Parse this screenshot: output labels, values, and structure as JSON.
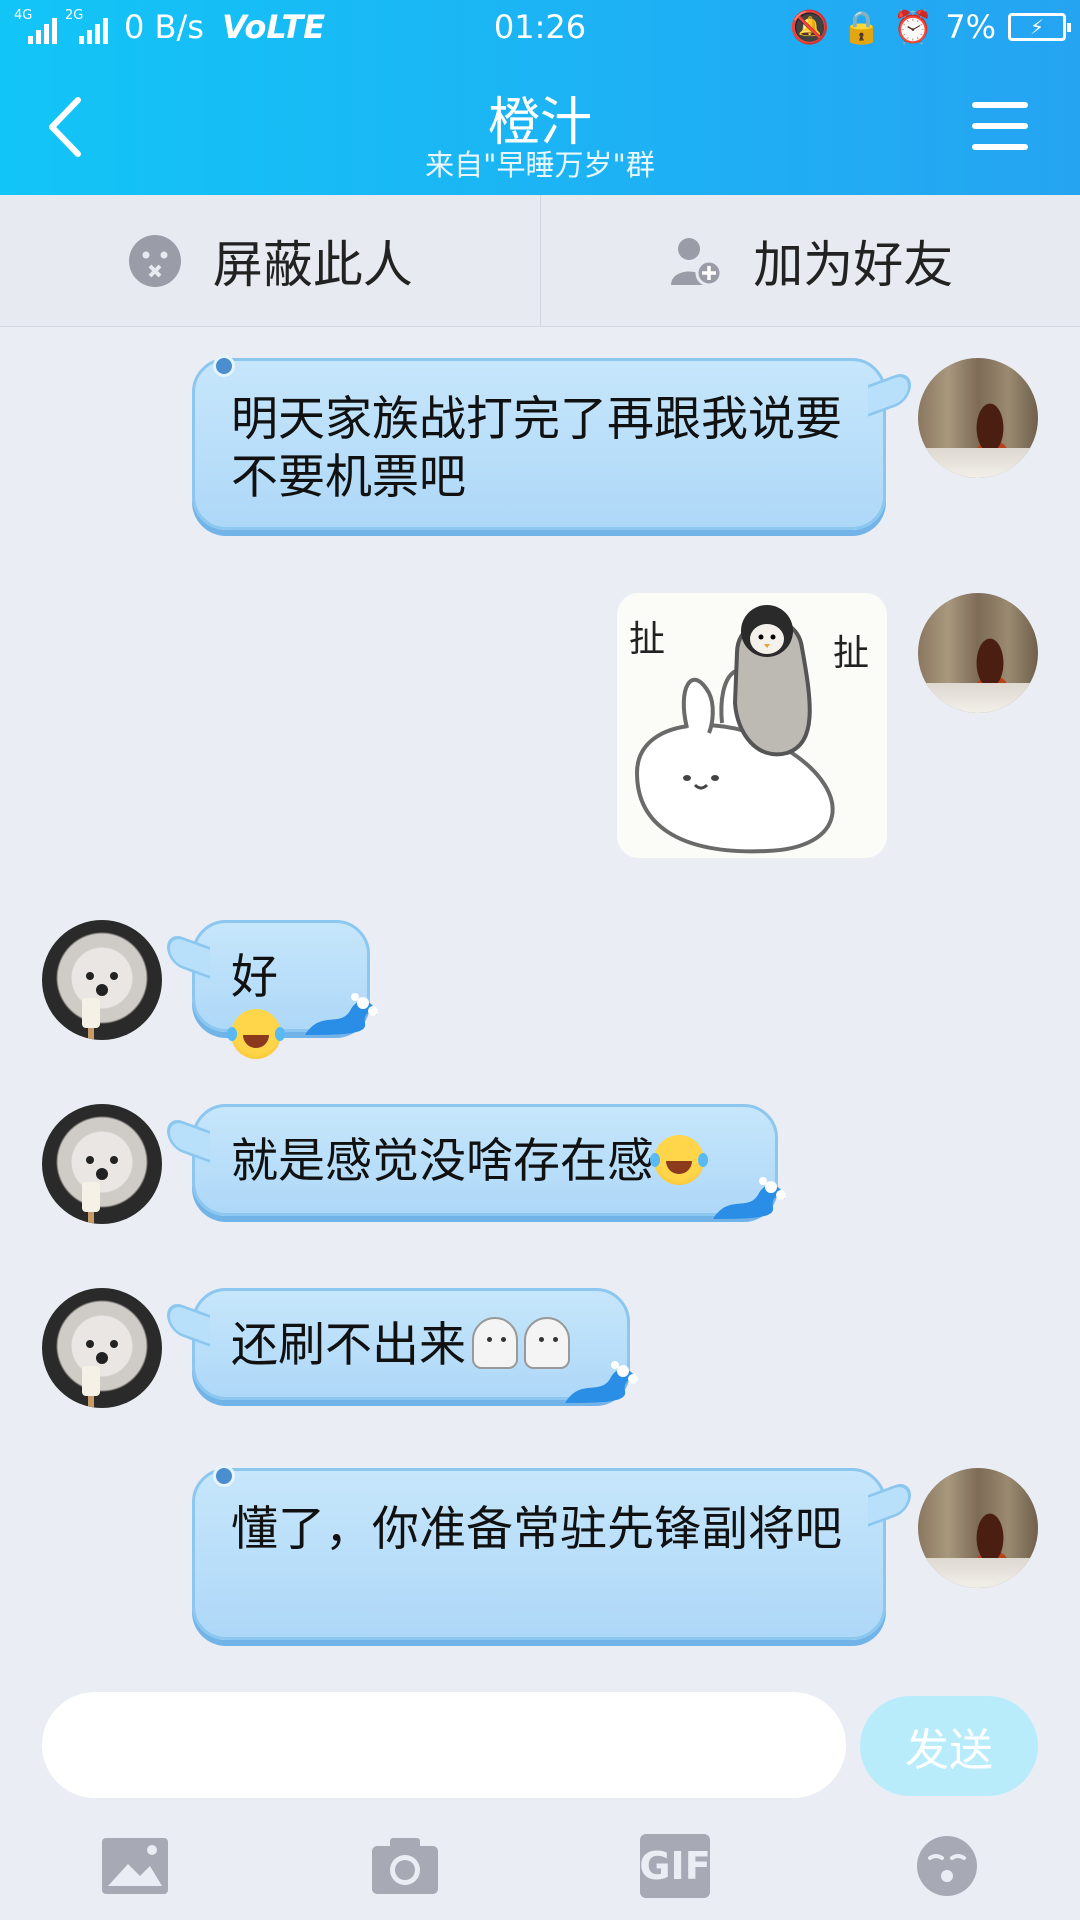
{
  "status_bar": {
    "network_1": "4G",
    "network_2": "2G",
    "speed": "0 B/s",
    "volte": "VoLTE",
    "time": "01:26",
    "battery": "7%"
  },
  "header": {
    "title": "橙汁",
    "subtitle": "来自\"早睡万岁\"群"
  },
  "actions": {
    "block_label": "屏蔽此人",
    "add_friend_label": "加为好友"
  },
  "messages": [
    {
      "sender": "me",
      "text": "明天家族战打完了再跟我说要不要机票吧"
    },
    {
      "sender": "me",
      "type": "sticker",
      "sticker_left": "扯",
      "sticker_right": "扯"
    },
    {
      "sender": "friend",
      "text": "好"
    },
    {
      "sender": "friend",
      "text": "就是感觉没啥存在感"
    },
    {
      "sender": "friend",
      "text": "还刷不出来"
    },
    {
      "sender": "me",
      "text": "懂了，你准备常驻先锋副将吧"
    }
  ],
  "composer": {
    "placeholder": "",
    "send_label": "发送"
  },
  "toolbar": {
    "gif_label": "GIF"
  },
  "colors": {
    "header_start": "#12c5f7",
    "header_end": "#25a4f2",
    "bubble": "#b2dcf9",
    "send_button": "#b8ecfb",
    "background": "#ebedf5"
  }
}
